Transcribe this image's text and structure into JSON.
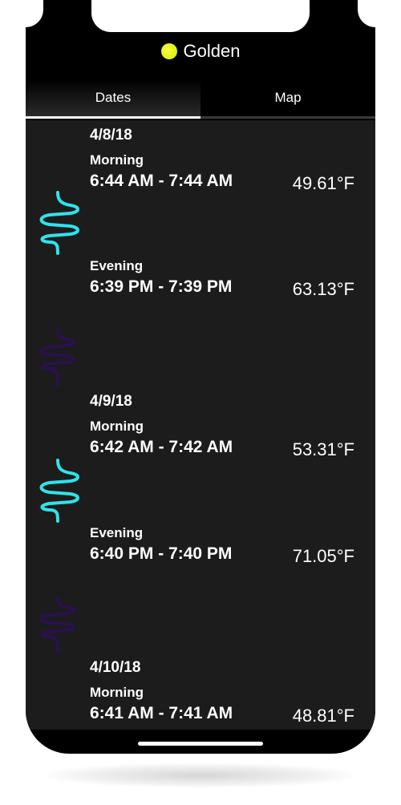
{
  "header": {
    "title": "Golden",
    "sun_color": "#e2f21a"
  },
  "tabs": [
    {
      "label": "Dates",
      "active": true
    },
    {
      "label": "Map",
      "active": false
    }
  ],
  "days": [
    {
      "date": "4/8/18",
      "morning": {
        "label": "Morning",
        "time": "6:44 AM - 7:44 AM",
        "temp": "49.61°F"
      },
      "evening": {
        "label": "Evening",
        "time": "6:39 PM - 7:39 PM",
        "temp": "63.13°F"
      }
    },
    {
      "date": "4/9/18",
      "morning": {
        "label": "Morning",
        "time": "6:42 AM - 7:42 AM",
        "temp": "53.31°F"
      },
      "evening": {
        "label": "Evening",
        "time": "6:40 PM - 7:40 PM",
        "temp": "71.05°F"
      }
    },
    {
      "date": "4/10/18",
      "morning": {
        "label": "Morning",
        "time": "6:41 AM - 7:41 AM",
        "temp": "48.81°F"
      }
    }
  ],
  "colors": {
    "cyan": "#2fe3ec",
    "orange": "#ff6a2a",
    "magenta": "#d13bd7",
    "purple": "#2a1050"
  }
}
